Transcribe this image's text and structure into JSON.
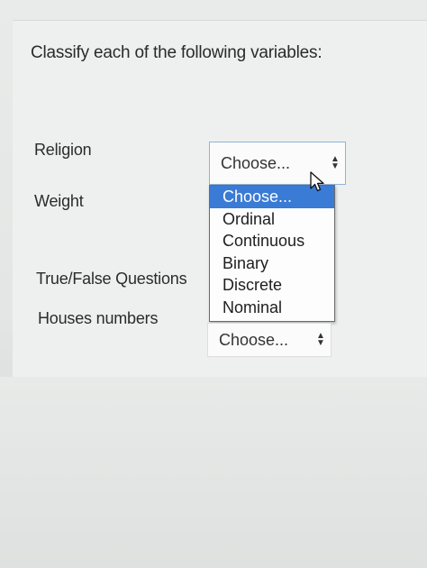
{
  "question": "Classify each of the following variables:",
  "rows": [
    {
      "label": "Religion",
      "select_value": "Choose..."
    },
    {
      "label": "Weight"
    },
    {
      "label": "True/False Questions"
    },
    {
      "label": "Houses numbers",
      "select_value": "Choose..."
    }
  ],
  "dropdown": {
    "options": [
      "Choose...",
      "Ordinal",
      "Continuous",
      "Binary",
      "Discrete",
      "Nominal"
    ],
    "highlighted": "Choose..."
  },
  "colors": {
    "highlight": "#3a7bd5",
    "select_border": "#a9c3e0"
  },
  "icons": {
    "select_arrows": "updown-arrows-icon",
    "cursor": "mouse-pointer-icon"
  }
}
